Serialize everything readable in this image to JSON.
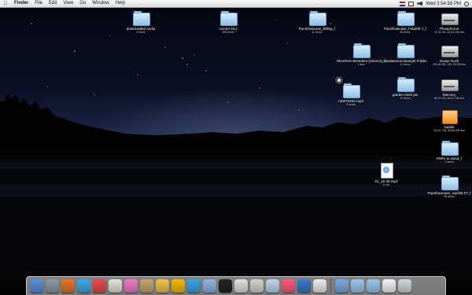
{
  "menubar": {
    "apple": "",
    "app_name": "Finder",
    "menus": [
      "File",
      "Edit",
      "View",
      "Go",
      "Window",
      "Help"
    ],
    "clock": "Wed 3:54:59 PM"
  },
  "desktop_items": [
    {
      "type": "folder",
      "label": "downloaded audio",
      "sub": "9 items"
    },
    {
      "type": "folder",
      "label": "comics DLs",
      "sub": "355 items"
    },
    {
      "type": "folder",
      "label": "PacShowcase_Billing_f",
      "sub": "11 items"
    },
    {
      "type": "folder",
      "label": "PacShowcase_Feb200 7_f",
      "sub": "85 items"
    },
    {
      "type": "disk",
      "label": "Phosphorus",
      "sub": "76.33 GB, 44.84 GB free"
    },
    {
      "type": "folder",
      "label": "Shorthorn Breeders Directory_f",
      "sub": "1 item"
    },
    {
      "type": "folder",
      "label": "bandaresonutsaright Folder",
      "sub": "11 items"
    },
    {
      "type": "disk",
      "label": "Dump Truck",
      "sub": "233.45 GB, 120.78 GB free"
    },
    {
      "type": "folder",
      "label": "r20070202-mp3",
      "sub": "5 items"
    },
    {
      "type": "folder",
      "label": "garden 0423 pix",
      "sub": "11 items"
    },
    {
      "type": "disk",
      "label": "Mercury",
      "sub": "68.75 GB, 45.57 GB free"
    },
    {
      "type": "ipod",
      "label": "Jupiter",
      "sub": "111.57 GB, 45.66 GB free"
    },
    {
      "type": "folder",
      "label": "PDFs to Send_f",
      "sub": "2 items"
    },
    {
      "type": "mp3",
      "label": "01_15-33.mp3",
      "sub": "19 kb"
    },
    {
      "type": "folder",
      "label": "PacShowcase_April20 07_f",
      "sub": "99 items"
    }
  ],
  "dock": {
    "apps": [
      {
        "icon": "finder-icon",
        "color": "#5a8fdc"
      },
      {
        "icon": "system-preferences-icon",
        "color": "#8e9aa6"
      },
      {
        "icon": "firefox-icon",
        "color": "#e5752a"
      },
      {
        "icon": "itunes-icon",
        "color": "#3fa8e8"
      },
      {
        "icon": "ical-icon",
        "color": "#e84a4a"
      },
      {
        "icon": "textedit-icon",
        "color": "#e3e3d8"
      },
      {
        "icon": "pinwheel-icon",
        "color": "#f07bc4"
      },
      {
        "icon": "script-icon",
        "color": "#c6a76a"
      },
      {
        "icon": "photoshop-icon",
        "color": "#f2c14a"
      },
      {
        "icon": "illustrator-icon",
        "color": "#f5b800"
      },
      {
        "icon": "help-viewer-icon",
        "color": "#38a5e6"
      },
      {
        "icon": "safari-icon",
        "color": "#8fb5e2"
      },
      {
        "icon": "dvd-player-icon",
        "color": "#222222"
      },
      {
        "icon": "dvd-disc-icon",
        "color": "#e0e0e0"
      },
      {
        "icon": "cowbell-icon",
        "color": "#d4d4c8"
      },
      {
        "icon": "bluetooth-icon",
        "color": "#bcd7ef"
      },
      {
        "icon": "pen-tool-icon",
        "color": "#ff5a7a"
      },
      {
        "icon": "globe-icon",
        "color": "#3a78c8"
      },
      {
        "icon": "document-icon",
        "color": "#eaeaea"
      }
    ],
    "stacks": [
      {
        "icon": "applications-folder-icon",
        "color": "#7aa9e0"
      },
      {
        "icon": "downloads-folder-icon",
        "color": "#9cc6ea"
      },
      {
        "icon": "documents-folder-icon",
        "color": "#9cc6ea"
      },
      {
        "icon": "text-file-icon",
        "color": "#f4f4f4"
      },
      {
        "icon": "trash-icon",
        "color": "#cfd6dc"
      }
    ]
  }
}
